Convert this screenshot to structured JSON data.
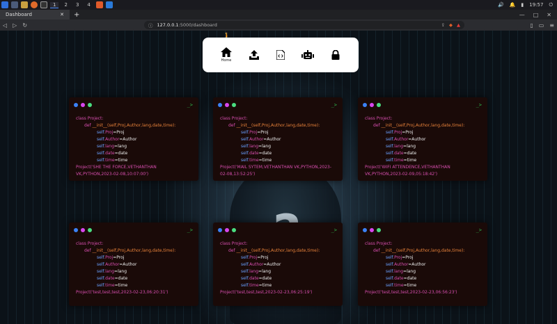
{
  "taskbar": {
    "workspaces": [
      "1",
      "2",
      "3",
      "4"
    ],
    "clock": "19:57"
  },
  "browser": {
    "tab_title": "Dashboard",
    "new_tab": "+",
    "url_host": "127.0.0.1",
    "url_rest": ":5000/dashboard"
  },
  "nav": {
    "items": [
      {
        "icon": "home-icon",
        "label": "Home"
      },
      {
        "icon": "upload-icon",
        "label": ""
      },
      {
        "icon": "code-file-icon",
        "label": ""
      },
      {
        "icon": "robot-icon",
        "label": ""
      },
      {
        "icon": "lock-icon",
        "label": ""
      }
    ]
  },
  "colors": {
    "dot_blue": "#3b82f6",
    "dot_pink": "#d946ef",
    "dot_green": "#4ade80",
    "card_bg": "#1a0a08"
  },
  "code": {
    "class_line": "class Project:",
    "def_line": "def __init__(self,Proj,Author,lang,date,time):",
    "def_kw": "def",
    "def_name": "__init__",
    "def_args": "(self,Proj,Author,lang,date,time):",
    "self": "self",
    "assign": [
      {
        "attr": ".Proj",
        "val": "=Proj"
      },
      {
        "attr": ".Author",
        "val": "=Author"
      },
      {
        "attr": ".lang",
        "val": "=lang"
      },
      {
        "attr": ".date",
        "val": "=date"
      },
      {
        "attr": ".time",
        "val": "=time"
      }
    ],
    "prompt": "_>"
  },
  "cards": [
    {
      "call": "Project('SHE THE FORCE,VETHANTHAN VK,PYTHON,2023-02-08,10:07:00')"
    },
    {
      "call": "Project('MAIL SYTEM,VETHANTHAN VK,PYTHON,2023-02-08,13:52:25')"
    },
    {
      "call": "Project('WIFI ATTENDENCE,VETHANTHAN VK,PYTHON,2023-02-09,05:18:42')"
    },
    {
      "call": "Project('test,test,test,2023-02-23,06:20:31')"
    },
    {
      "call": "Project('test,test,test,2023-02-23,06:25:19')"
    },
    {
      "call": "Project('test,test,test,2023-02-23,06:56:23')"
    }
  ]
}
